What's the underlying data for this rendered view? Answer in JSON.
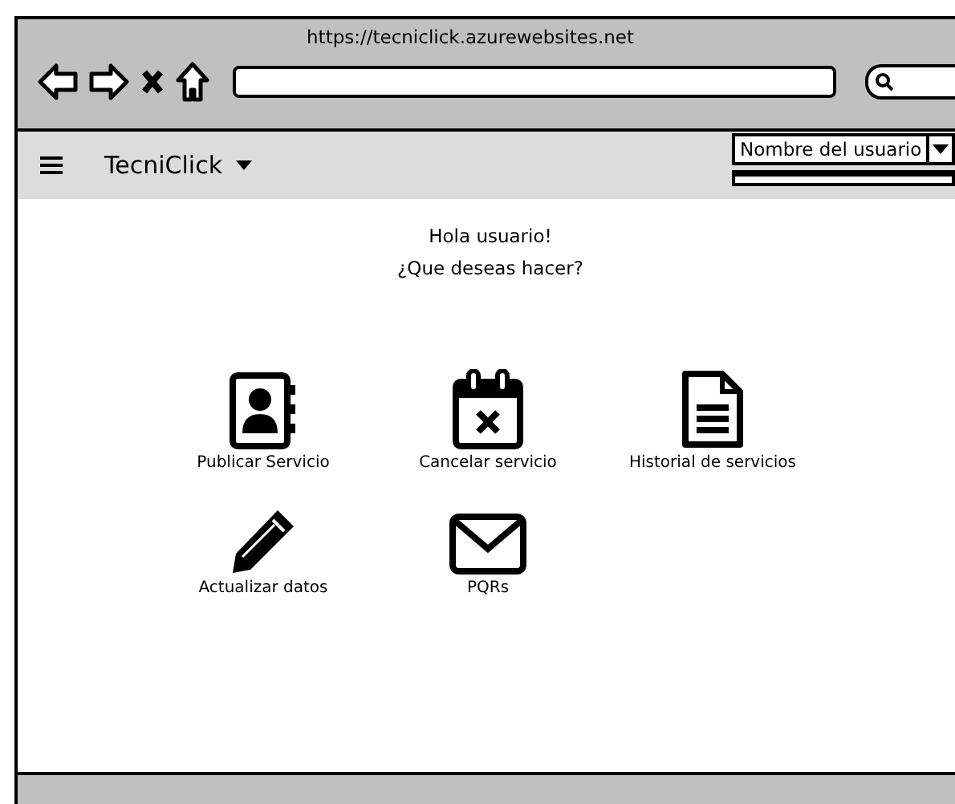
{
  "browser": {
    "url": "https://tecniclick.azurewebsites.net"
  },
  "navbar": {
    "brand": "TecniClick",
    "user_dropdown": {
      "value": "Nombre del usuario"
    }
  },
  "greeting": [
    "Hola usuario!",
    "¿Que deseas hacer?"
  ],
  "actions": [
    {
      "kind": "contacts",
      "label": "Publicar Servicio"
    },
    {
      "kind": "calendar",
      "label": "Cancelar servicio"
    },
    {
      "kind": "document",
      "label": "Historial de servicios"
    },
    {
      "kind": "pencil",
      "label": "Actualizar datos"
    },
    {
      "kind": "mail",
      "label": "PQRs"
    }
  ]
}
